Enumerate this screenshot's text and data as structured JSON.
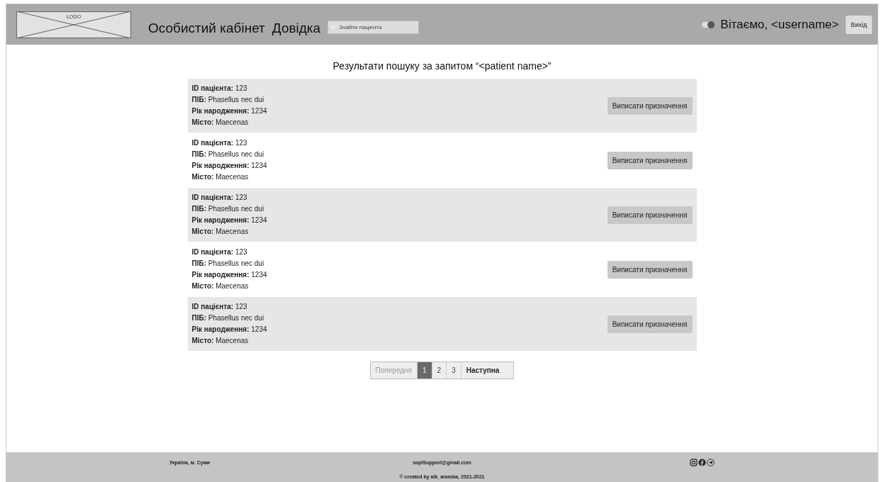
{
  "header": {
    "logo": "LOGO",
    "nav": [
      "Особистий кабінет",
      "Довідка"
    ],
    "search": {
      "placeholder": "Знайти пацієнта"
    },
    "theme_switch": {
      "on": true
    },
    "greeting": "Вітаємо, <username>",
    "logout": "Вихід"
  },
  "results": {
    "title": "Результати пошуку за запитом “<patient name>”",
    "patients": [
      {
        "lines": [
          "**ID пацієнта:** 123",
          "**ПІБ:** Phasellus nec dui",
          "**Рік народження:** 1234",
          "**Місто:** Maecenas"
        ],
        "action": "Виписати призначення"
      },
      {
        "lines": [
          "**ID пацієнта:** 123",
          "**ПІБ:** Phasellus nec dui",
          "**Рік народження:** 1234",
          "**Місто:** Maecenas"
        ],
        "action": "Виписати призначення"
      },
      {
        "lines": [
          "**ID пацієнта:** 123",
          "**ПІБ:** Phasellus nec dui",
          "**Рік народження:** 1234",
          "**Місто:** Maecenas"
        ],
        "action": "Виписати призначення"
      },
      {
        "lines": [
          "**ID пацієнта:** 123",
          "**ПІБ:** Phasellus nec dui",
          "**Рік народження:** 1234",
          "**Місто:** Maecenas"
        ],
        "action": "Виписати призначення"
      },
      {
        "lines": [
          "**ID пацієнта:** 123",
          "**ПІБ:** Phasellus nec dui",
          "**Рік народження:** 1234",
          "**Місто:** Maecenas"
        ],
        "action": "Виписати призначення"
      }
    ]
  },
  "pagination": {
    "previous": {
      "label": "Попередня",
      "disabled": true
    },
    "pages": [
      {
        "label": "1",
        "selected": true
      },
      {
        "label": "2",
        "selected": false
      },
      {
        "label": "3",
        "selected": false
      }
    ],
    "next": {
      "label": "Наступна",
      "disabled": false
    }
  },
  "footer": {
    "location": "Україна, м. Суми",
    "email": "soplSupport@gmail.com",
    "copyright": "© created by aik_aramba, 2021-2021"
  }
}
